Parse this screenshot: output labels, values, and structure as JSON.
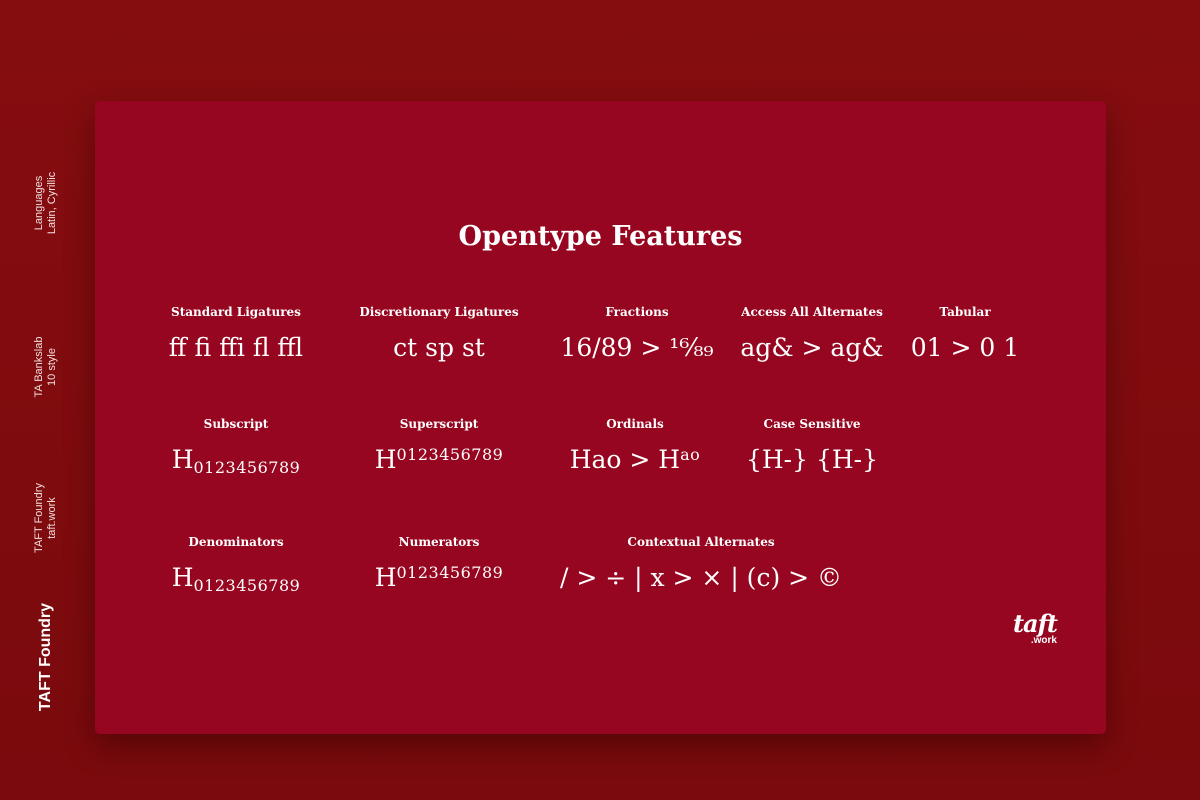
{
  "sidebar": {
    "languages": {
      "line1": "Languages",
      "line2": "Latin, Cyrillic"
    },
    "family": {
      "line1": "TA Bankslab",
      "line2": "10 style"
    },
    "foundry": {
      "line1": "TAFT Foundry",
      "line2": "taft.work"
    },
    "brand": "TAFT Foundry"
  },
  "card": {
    "title": "Opentype Features",
    "features": {
      "standard_ligatures": {
        "label": "Standard Ligatures",
        "sample": "ff fi ffi fl ffl"
      },
      "discretionary_ligatures": {
        "label": "Discretionary Ligatures",
        "sample": "ct sp st"
      },
      "fractions": {
        "label": "Fractions",
        "sample": "16/89 > ¹⁶⁄₈₉"
      },
      "access_all_alternates": {
        "label": "Access All Alternates",
        "sample": "ag& > ag&"
      },
      "tabular": {
        "label": "Tabular",
        "sample": "01 > 0 1"
      },
      "subscript": {
        "label": "Subscript",
        "base": "H",
        "digits": "0123456789"
      },
      "superscript": {
        "label": "Superscript",
        "base": "H",
        "digits": "0123456789"
      },
      "ordinals": {
        "label": "Ordinals",
        "sample_base": "Hao > H",
        "sample_sup": "ao"
      },
      "case_sensitive": {
        "label": "Case Sensitive",
        "sample": "{H-} {H-}"
      },
      "denominators": {
        "label": "Denominators",
        "base": "H",
        "digits": "0123456789"
      },
      "numerators": {
        "label": "Numerators",
        "base": "H",
        "digits": "0123456789"
      },
      "contextual_alternates": {
        "label": "Contextual Alternates",
        "sample": "/ > ÷ | x > × | (c) > ©"
      }
    },
    "logo": {
      "main": "taft",
      "sub": ".work"
    }
  },
  "colors": {
    "background": "#850d10",
    "card": "#960620",
    "text": "#ffffff"
  }
}
